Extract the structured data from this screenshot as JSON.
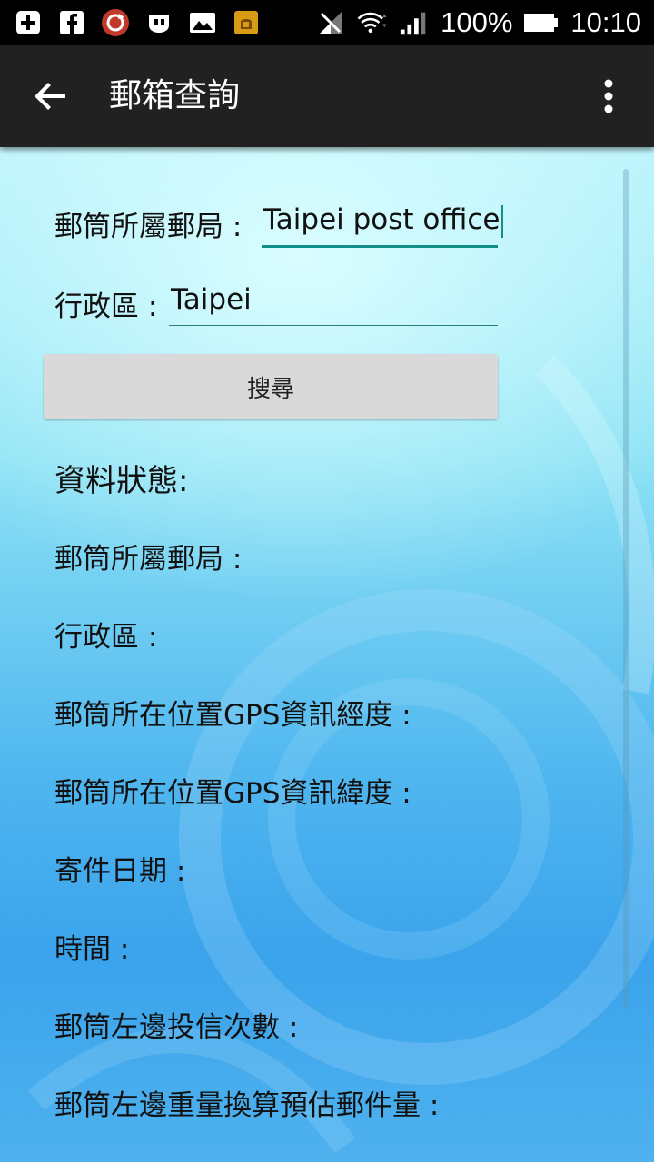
{
  "status_bar": {
    "battery": "100%",
    "time": "10:10",
    "icons": [
      "add-box-icon",
      "facebook-icon",
      "sync-app-icon",
      "chat-app-icon",
      "image-icon",
      "android-app-icon",
      "signal-off-icon",
      "wifi-icon",
      "cell-signal-icon",
      "battery-icon"
    ]
  },
  "appbar": {
    "title": "郵箱查詢"
  },
  "form": {
    "post_office_label": "郵筒所屬郵局 :",
    "post_office_value": "Taipei post office",
    "district_label": "行政區 :",
    "district_value": "Taipei",
    "search_button": "搜尋"
  },
  "status": {
    "title": "資料狀態:",
    "fields": [
      "郵筒所屬郵局 :",
      "行政區 :",
      "郵筒所在位置GPS資訊經度 :",
      "郵筒所在位置GPS資訊緯度 :",
      "寄件日期 :",
      "時間 :",
      "郵筒左邊投信次數 :",
      "郵筒左邊重量換算預估郵件量 :"
    ]
  },
  "colors": {
    "appbar": "#212121",
    "accent": "#0f8f86",
    "button": "#d9d9d9"
  }
}
